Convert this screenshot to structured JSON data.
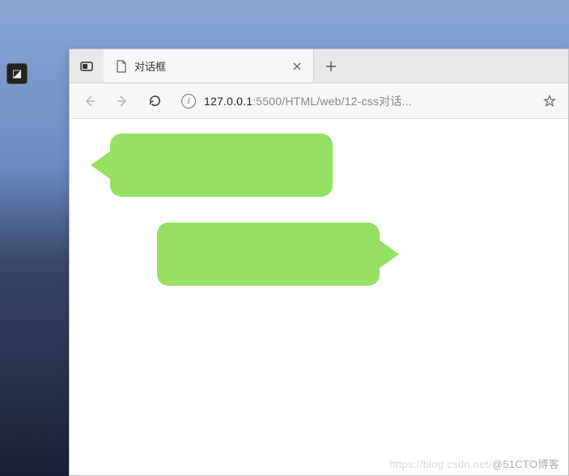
{
  "tab": {
    "title": "对话框"
  },
  "address": {
    "host": "127.0.0.1",
    "port": ":5500",
    "path": "/HTML/web/12-css对话..."
  },
  "colors": {
    "bubble": "#95e062"
  },
  "watermark": {
    "faint": "https://blog.csdn.net/",
    "text": "@51CTO博客"
  }
}
